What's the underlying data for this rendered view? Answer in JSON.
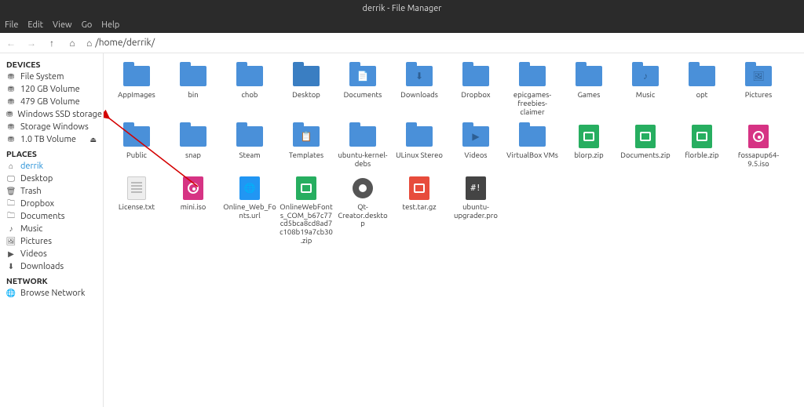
{
  "window": {
    "title": "derrik - File Manager"
  },
  "menu": {
    "items": [
      "File",
      "Edit",
      "View",
      "Go",
      "Help"
    ]
  },
  "toolbar": {
    "path_display": "/home/derrik/"
  },
  "sidebar": {
    "devices_header": "DEVICES",
    "devices": [
      {
        "label": "File System",
        "icon": "drive"
      },
      {
        "label": "120 GB Volume",
        "icon": "drive"
      },
      {
        "label": "479 GB Volume",
        "icon": "drive"
      },
      {
        "label": "Windows SSD storage",
        "icon": "drive"
      },
      {
        "label": "Storage Windows",
        "icon": "drive"
      },
      {
        "label": "1.0 TB Volume",
        "icon": "drive",
        "eject": true
      }
    ],
    "places_header": "PLACES",
    "places": [
      {
        "label": "derrik",
        "icon": "home",
        "active": true
      },
      {
        "label": "Desktop",
        "icon": "desktop"
      },
      {
        "label": "Trash",
        "icon": "trash"
      },
      {
        "label": "Dropbox",
        "icon": "folder"
      },
      {
        "label": "Documents",
        "icon": "folder"
      },
      {
        "label": "Music",
        "icon": "music"
      },
      {
        "label": "Pictures",
        "icon": "pictures"
      },
      {
        "label": "Videos",
        "icon": "videos"
      },
      {
        "label": "Downloads",
        "icon": "downloads"
      }
    ],
    "network_header": "NETWORK",
    "network": [
      {
        "label": "Browse Network",
        "icon": "network"
      }
    ]
  },
  "files": [
    {
      "name": "AppImages",
      "type": "folder"
    },
    {
      "name": "bin",
      "type": "folder"
    },
    {
      "name": "chob",
      "type": "folder"
    },
    {
      "name": "Desktop",
      "type": "folder",
      "variant": "dark"
    },
    {
      "name": "Documents",
      "type": "folder",
      "glyph": "📄"
    },
    {
      "name": "Downloads",
      "type": "folder",
      "glyph": "⬇"
    },
    {
      "name": "Dropbox",
      "type": "folder"
    },
    {
      "name": "epicgames-freebies-claimer",
      "type": "folder"
    },
    {
      "name": "Games",
      "type": "folder"
    },
    {
      "name": "Music",
      "type": "folder",
      "glyph": "♪"
    },
    {
      "name": "opt",
      "type": "folder"
    },
    {
      "name": "Pictures",
      "type": "folder",
      "glyph": "🖼"
    },
    {
      "name": "Public",
      "type": "folder"
    },
    {
      "name": "snap",
      "type": "folder"
    },
    {
      "name": "Steam",
      "type": "folder"
    },
    {
      "name": "Templates",
      "type": "folder",
      "glyph": "📋"
    },
    {
      "name": "ubuntu-kernel-debs",
      "type": "folder"
    },
    {
      "name": "ULinux Stereo",
      "type": "folder"
    },
    {
      "name": "Videos",
      "type": "folder",
      "glyph": "▶"
    },
    {
      "name": "VirtualBox VMs",
      "type": "folder"
    },
    {
      "name": "blorp.zip",
      "type": "zip"
    },
    {
      "name": "Documents.zip",
      "type": "zip"
    },
    {
      "name": "florble.zip",
      "type": "zip"
    },
    {
      "name": "fossapup64-9.5.iso",
      "type": "iso"
    },
    {
      "name": "License.txt",
      "type": "doc"
    },
    {
      "name": "mini.iso",
      "type": "iso"
    },
    {
      "name": "Online_Web_Fonts.url",
      "type": "url"
    },
    {
      "name": "OnlineWebFonts_COM_b67c77cd5bca8cd8ad7c108b19a7cb30.zip",
      "type": "zip"
    },
    {
      "name": "Qt-Creator.desktop",
      "type": "gear"
    },
    {
      "name": "test.tar.gz",
      "type": "tar"
    },
    {
      "name": "ubuntu-upgrader.pro",
      "type": "script"
    }
  ],
  "icon_glyphs": {
    "drive": "⛃",
    "home": "⌂",
    "desktop": "🖵",
    "trash": "🗑",
    "folder": "🗀",
    "music": "♪",
    "pictures": "🖼",
    "videos": "▶",
    "downloads": "⬇",
    "network": "🌐"
  }
}
